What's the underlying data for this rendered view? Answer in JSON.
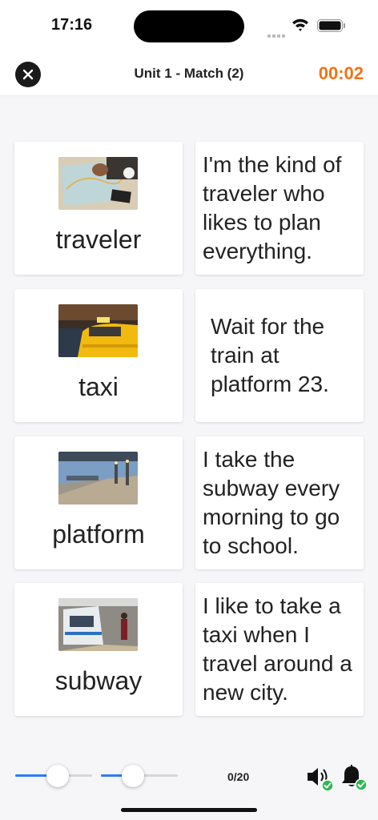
{
  "status_bar": {
    "time": "17:16"
  },
  "header": {
    "title": "Unit 1 - Match (2)",
    "timer": "00:02",
    "timer_color": "#f47216",
    "close_icon": "close-icon"
  },
  "word_cards": [
    {
      "label": "traveler",
      "image": "map-planning-photo"
    },
    {
      "label": "taxi",
      "image": "taxi-cab-photo"
    },
    {
      "label": "platform",
      "image": "train-platform-photo"
    },
    {
      "label": "subway",
      "image": "subway-train-photo"
    }
  ],
  "sentence_cards": [
    {
      "text": "I'm the kind of traveler who likes to plan everything."
    },
    {
      "text": "Wait for the train at platform 23."
    },
    {
      "text": "I take the subway every morning to go to school."
    },
    {
      "text": "I like to take a taxi when I travel around a new city."
    }
  ],
  "bottom_bar": {
    "slider_1_level": 0.55,
    "slider_2_level": 0.42,
    "slider_color": "#2b7cf6",
    "progress": "0/20",
    "speaker_icon": "speaker-icon",
    "bell_icon": "bell-icon",
    "check_color": "#2db84d"
  }
}
